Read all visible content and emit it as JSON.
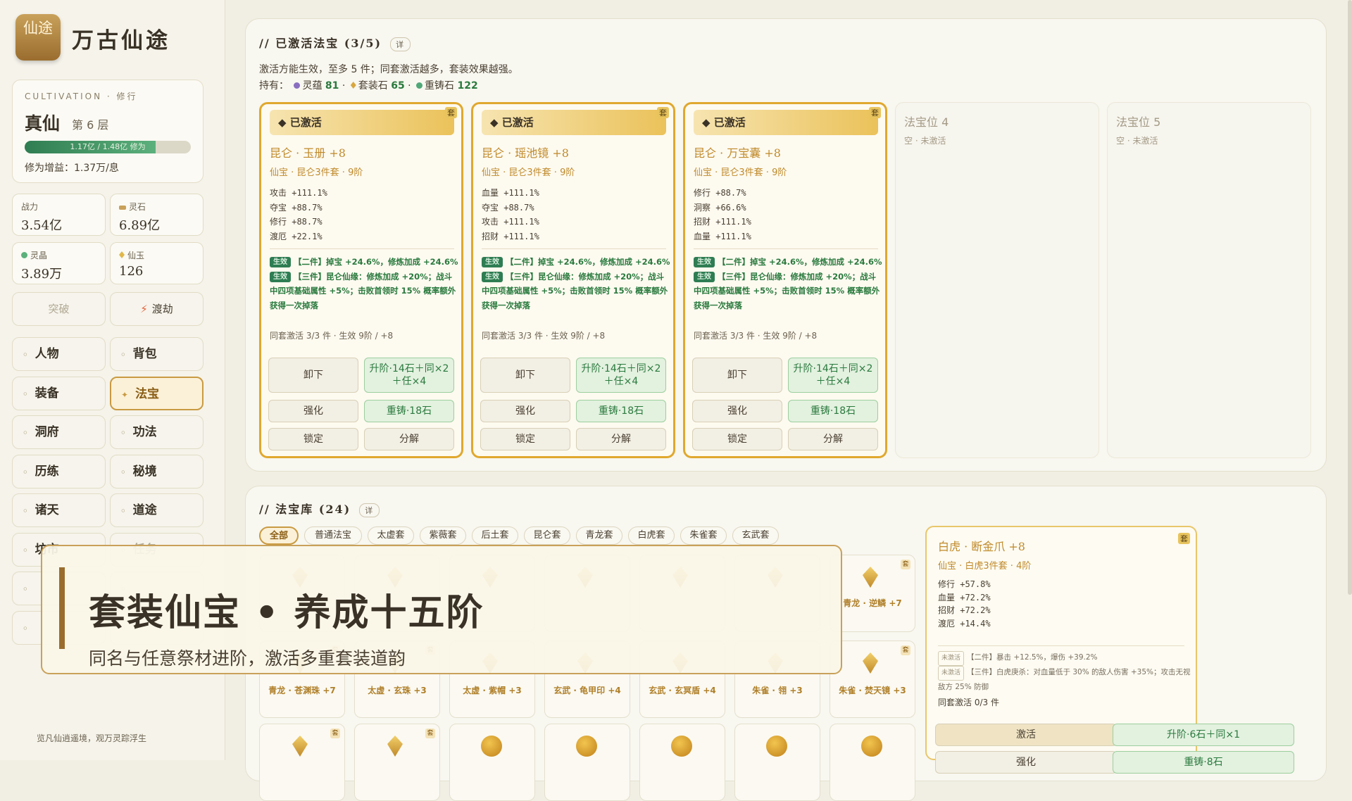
{
  "app": {
    "logo": "仙途",
    "name": "万古仙途"
  },
  "cultivation": {
    "tag": "CULTIVATION · 修行",
    "realm": "真仙",
    "layer": "第 6 层",
    "progress_text": "1.17亿 / 1.48亿 修为",
    "progress": 0.79,
    "rate": "修为增益：1.37万/息"
  },
  "stats": [
    {
      "label": "战力",
      "value": "3.54亿",
      "icon": "power-icon"
    },
    {
      "label": "灵石",
      "value": "6.89亿",
      "icon": "spirit-stone-icon"
    },
    {
      "label": "灵晶",
      "value": "3.89万",
      "icon": "spirit-crystal-icon"
    },
    {
      "label": "仙玉",
      "value": "126",
      "icon": "jade-icon"
    }
  ],
  "actions": {
    "breakthrough": "突破",
    "tribulation": "渡劫"
  },
  "nav": [
    {
      "label": "人物"
    },
    {
      "label": "背包"
    },
    {
      "label": "装备"
    },
    {
      "label": "法宝"
    },
    {
      "label": "洞府"
    },
    {
      "label": "功法"
    },
    {
      "label": "历练"
    },
    {
      "label": "秘境"
    },
    {
      "label": "诸天"
    },
    {
      "label": "道途"
    },
    {
      "label": "坊市"
    },
    {
      "label": "任务"
    }
  ],
  "footer": "览凡仙逍遥境，观万灵踪浮生",
  "active_panel": {
    "title": "// 已激活法宝 (3/5)",
    "detail": "详",
    "desc": "激活方能生效，至多 5 件；同套激活越多，套装效果越强。",
    "holdings_label": "持有：",
    "holdings": [
      {
        "name": "灵蕴",
        "value": "81",
        "color": "#8a6fc0"
      },
      {
        "name": "套装石",
        "value": "65",
        "color": "#d8a640"
      },
      {
        "name": "重铸石",
        "value": "122",
        "color": "#4fa878"
      }
    ],
    "cards": [
      {
        "status": "已激活",
        "badge": "套",
        "name": "昆仑 · 玉册 +8",
        "meta": "仙宝 · 昆仑3件套 · 9阶",
        "stats": [
          "攻击 +111.1%",
          "夺宝 +88.7%",
          "修行 +88.7%",
          "渡厄 +22.1%"
        ]
      },
      {
        "status": "已激活",
        "badge": "套",
        "name": "昆仑 · 瑶池镜 +8",
        "meta": "仙宝 · 昆仑3件套 · 9阶",
        "stats": [
          "血量 +111.1%",
          "夺宝 +88.7%",
          "攻击 +111.1%",
          "招财 +111.1%"
        ]
      },
      {
        "status": "已激活",
        "badge": "套",
        "name": "昆仑 · 万宝囊 +8",
        "meta": "仙宝 · 昆仑3件套 · 9阶",
        "stats": [
          "修行 +88.7%",
          "洞察 +66.6%",
          "招财 +111.1%",
          "血量 +111.1%"
        ]
      }
    ],
    "effect": {
      "tag": "生效",
      "e2": "【二件】掉宝 +24.6%，修炼加成 +24.6%",
      "e3": "【三件】昆仑仙缘：修炼加成 +20%；战斗中四项基础属性 +5%；击败首领时 15% 概率额外获得一次掉落",
      "set_line": "同套激活 3/3 件 · 生效 9阶 / +8"
    },
    "card_buttons": {
      "unequip": "卸下",
      "upgrade": "升阶·14石＋同×2＋任×4",
      "enhance": "强化",
      "reforge": "重铸·18石",
      "lock": "锁定",
      "decompose": "分解"
    },
    "empty_slots": [
      {
        "title": "法宝位 4",
        "sub": "空 · 未激活"
      },
      {
        "title": "法宝位 5",
        "sub": "空 · 未激活"
      }
    ]
  },
  "library": {
    "title": "// 法宝库 (24)",
    "detail": "详",
    "filters": [
      "全部",
      "普通法宝",
      "太虚套",
      "紫薇套",
      "后土套",
      "昆仑套",
      "青龙套",
      "白虎套",
      "朱雀套",
      "玄武套"
    ],
    "row1_last": {
      "name": "青龙 · 逆鳞 +7"
    },
    "row2": [
      {
        "name": "青龙 · 苍渊珠 +7"
      },
      {
        "name": "太虚 · 玄珠 +3"
      },
      {
        "name": "太虚 · 紫帽 +3"
      },
      {
        "name": "玄武 · 龟甲印 +4"
      },
      {
        "name": "玄武 · 玄冥盾 +4"
      },
      {
        "name": "朱雀 · 翎 +3"
      },
      {
        "name": "朱雀 · 焚天镜 +3"
      }
    ],
    "tile_badge": "套"
  },
  "detail_card": {
    "name": "白虎 · 断金爪 +8",
    "badge": "套",
    "meta": "仙宝 · 白虎3件套 · 4阶",
    "stats": [
      "修行 +57.8%",
      "血量 +72.2%",
      "招财 +72.2%",
      "渡厄 +14.4%"
    ],
    "inactive_tag": "未激活",
    "fx2": "【二件】暴击 +12.5%，爆伤 +39.2%",
    "fx3": "【三件】白虎庚杀：对血量低于 30% 的敌人伤害 +35%；攻击无视敌方 25% 防御",
    "set_line": "同套激活 0/3 件",
    "buttons": {
      "activate": "激活",
      "upgrade": "升阶·6石＋同×1",
      "enhance": "强化",
      "reforge": "重铸·8石"
    }
  },
  "banner": {
    "headline": "套装仙宝 • 养成十五阶",
    "sub": "同名与任意祭材进阶，激活多重套装道韵"
  }
}
